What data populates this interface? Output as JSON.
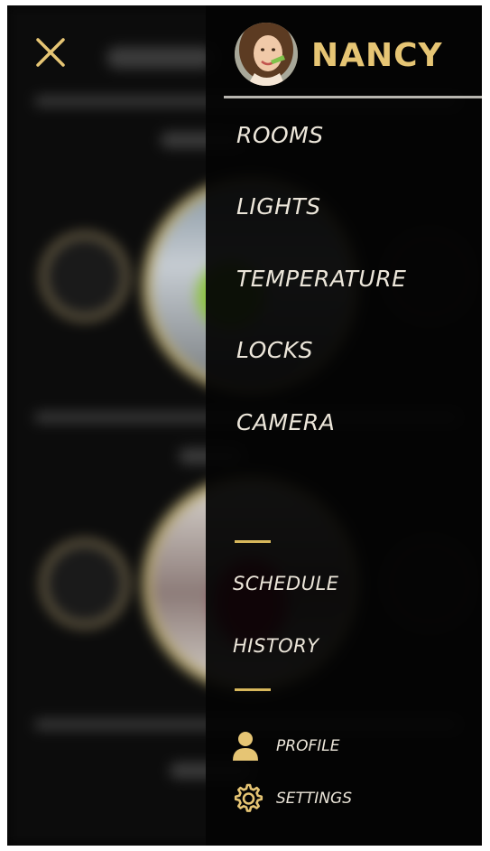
{
  "user": {
    "name": "NANCY"
  },
  "menu": {
    "items": [
      {
        "label": "ROOMS"
      },
      {
        "label": "LIGHTS"
      },
      {
        "label": "TEMPERATURE"
      },
      {
        "label": "LOCKS"
      },
      {
        "label": "CAMERA"
      }
    ],
    "secondary": [
      {
        "label": "SCHEDULE"
      },
      {
        "label": "HISTORY"
      }
    ],
    "footer": [
      {
        "label": "PROFILE",
        "icon": "person-icon"
      },
      {
        "label": "SETTINGS",
        "icon": "gear-icon"
      }
    ]
  },
  "colors": {
    "accent_gold": "#e6c574",
    "text_light": "#ece6da",
    "drawer_bg": "#040404"
  }
}
